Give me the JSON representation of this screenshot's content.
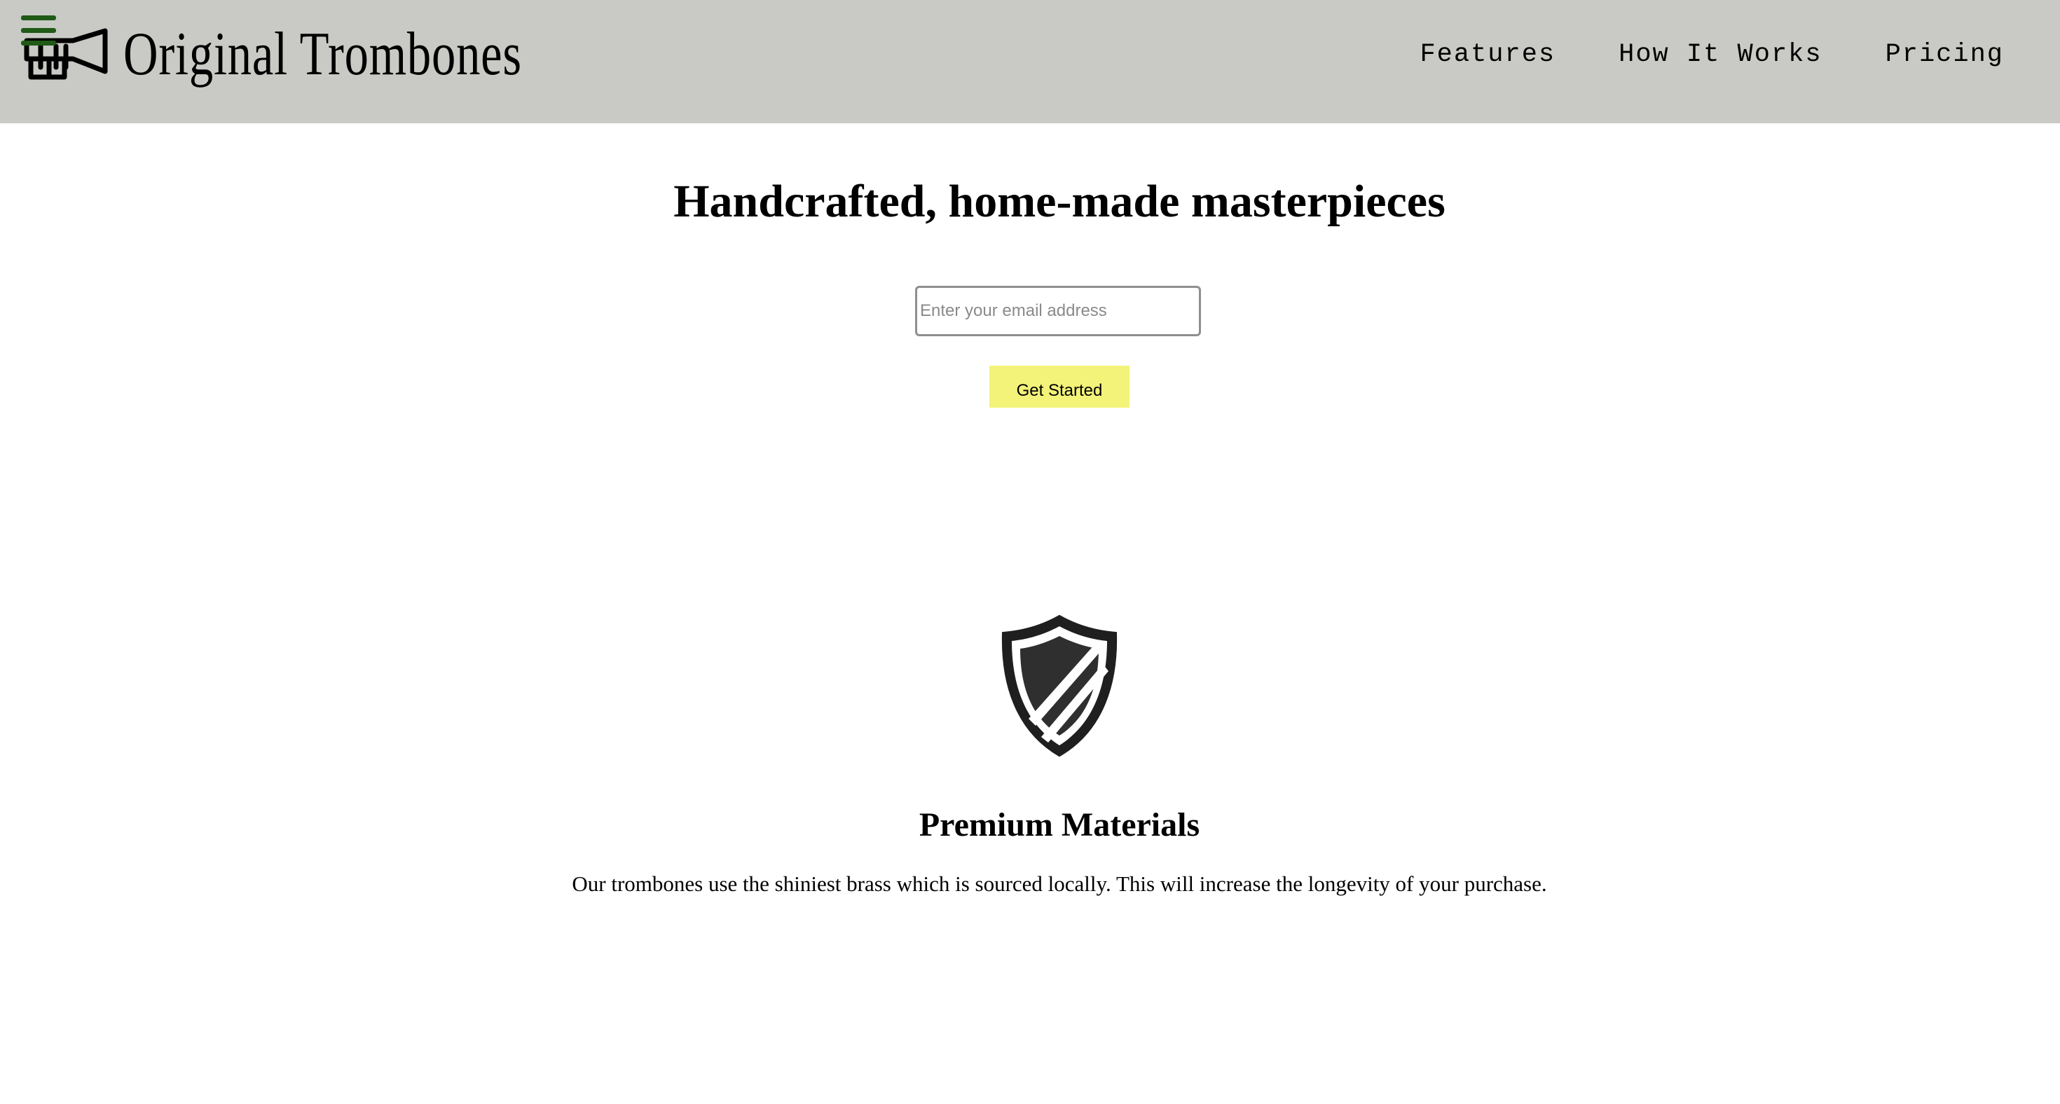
{
  "header": {
    "logo_text": "Original Trombones",
    "nav": {
      "features": "Features",
      "how_it_works": "How It Works",
      "pricing": "Pricing"
    },
    "background_color": "#c9cac5",
    "menu_icon_color": "#1f5a16"
  },
  "hero": {
    "title": "Handcrafted, home-made masterpieces",
    "email_placeholder": "Enter your email address",
    "cta_label": "Get Started",
    "cta_color": "#f3f379"
  },
  "feature": {
    "icon": "shield-icon",
    "title": "Premium Materials",
    "description": "Our trombones use the shiniest brass which is sourced locally. This will increase the longevity of your purchase."
  }
}
